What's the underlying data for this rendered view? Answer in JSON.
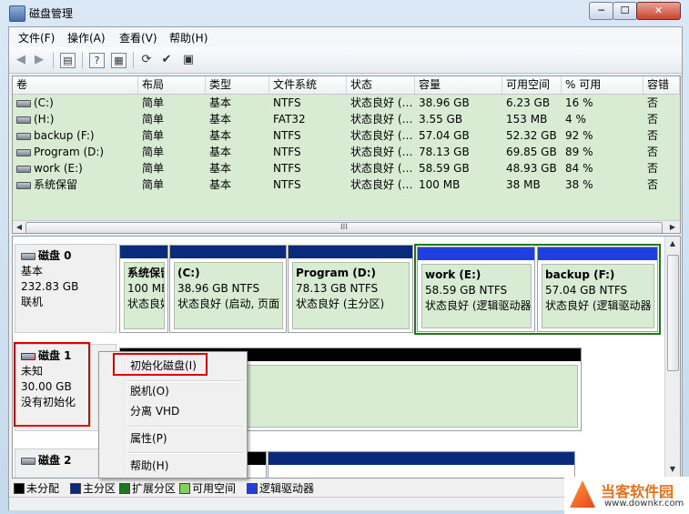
{
  "window": {
    "title": "磁盘管理",
    "min_label": "─",
    "max_label": "☐",
    "close_label": "✕"
  },
  "menu": [
    "文件(F)",
    "操作(A)",
    "查看(V)",
    "帮助(H)"
  ],
  "toolbar_icons": [
    "back-icon",
    "forward-icon",
    "console-tree-icon",
    "help-icon",
    "properties-icon",
    "refresh-icon",
    "settings-icon",
    "export-icon"
  ],
  "volume_list": {
    "columns": [
      "卷",
      "布局",
      "类型",
      "文件系统",
      "状态",
      "容量",
      "可用空间",
      "% 可用",
      "容错"
    ],
    "rows": [
      [
        "(C:)",
        "简单",
        "基本",
        "NTFS",
        "状态良好 (…",
        "38.96 GB",
        "6.23 GB",
        "16 %",
        "否"
      ],
      [
        "(H:)",
        "简单",
        "基本",
        "FAT32",
        "状态良好 (…",
        "3.55 GB",
        "153 MB",
        "4 %",
        "否"
      ],
      [
        "backup (F:)",
        "简单",
        "基本",
        "NTFS",
        "状态良好 (…",
        "57.04 GB",
        "52.32 GB",
        "92 %",
        "否"
      ],
      [
        "Program (D:)",
        "简单",
        "基本",
        "NTFS",
        "状态良好 (…",
        "78.13 GB",
        "69.85 GB",
        "89 %",
        "否"
      ],
      [
        "work (E:)",
        "简单",
        "基本",
        "NTFS",
        "状态良好 (…",
        "58.59 GB",
        "48.93 GB",
        "84 %",
        "否"
      ],
      [
        "系统保留",
        "简单",
        "基本",
        "NTFS",
        "状态良好 (…",
        "100 MB",
        "38 MB",
        "38 %",
        "否"
      ]
    ],
    "scroll_grip": "III"
  },
  "disks": {
    "disk0": {
      "name": "磁盘 0",
      "type": "基本",
      "size": "232.83 GB",
      "status": "联机",
      "partitions": [
        {
          "name": "系统保留",
          "line2": "100 MB",
          "line3": "状态良好"
        },
        {
          "name": "(C:)",
          "line2": "38.96 GB NTFS",
          "line3": "状态良好 (启动, 页面"
        },
        {
          "name": "Program  (D:)",
          "line2": "78.13 GB NTFS",
          "line3": "状态良好 (主分区)"
        },
        {
          "name": "work  (E:)",
          "line2": "58.59 GB NTFS",
          "line3": "状态良好 (逻辑驱动器"
        },
        {
          "name": "backup  (F:)",
          "line2": "57.04 GB NTFS",
          "line3": "状态良好 (逻辑驱动器"
        }
      ]
    },
    "disk1": {
      "name": "磁盘 1",
      "type": "未知",
      "size": "30.00 GB",
      "status": "没有初始化"
    },
    "disk2": {
      "name": "磁盘 2"
    }
  },
  "legend": [
    {
      "label": "未分配",
      "color": "#000000"
    },
    {
      "label": "主分区",
      "color": "#0a2a7c"
    },
    {
      "label": "扩展分区",
      "color": "#1a7a1a"
    },
    {
      "label": "可用空间",
      "color": "#7fd35a"
    },
    {
      "label": "逻辑驱动器",
      "color": "#1f3fe0"
    }
  ],
  "context_menu": [
    "初始化磁盘(I)",
    "脱机(O)",
    "分离 VHD",
    "属性(P)",
    "帮助(H)"
  ],
  "watermark": {
    "brand": "当客软件园",
    "url": "www.downkr.com"
  }
}
